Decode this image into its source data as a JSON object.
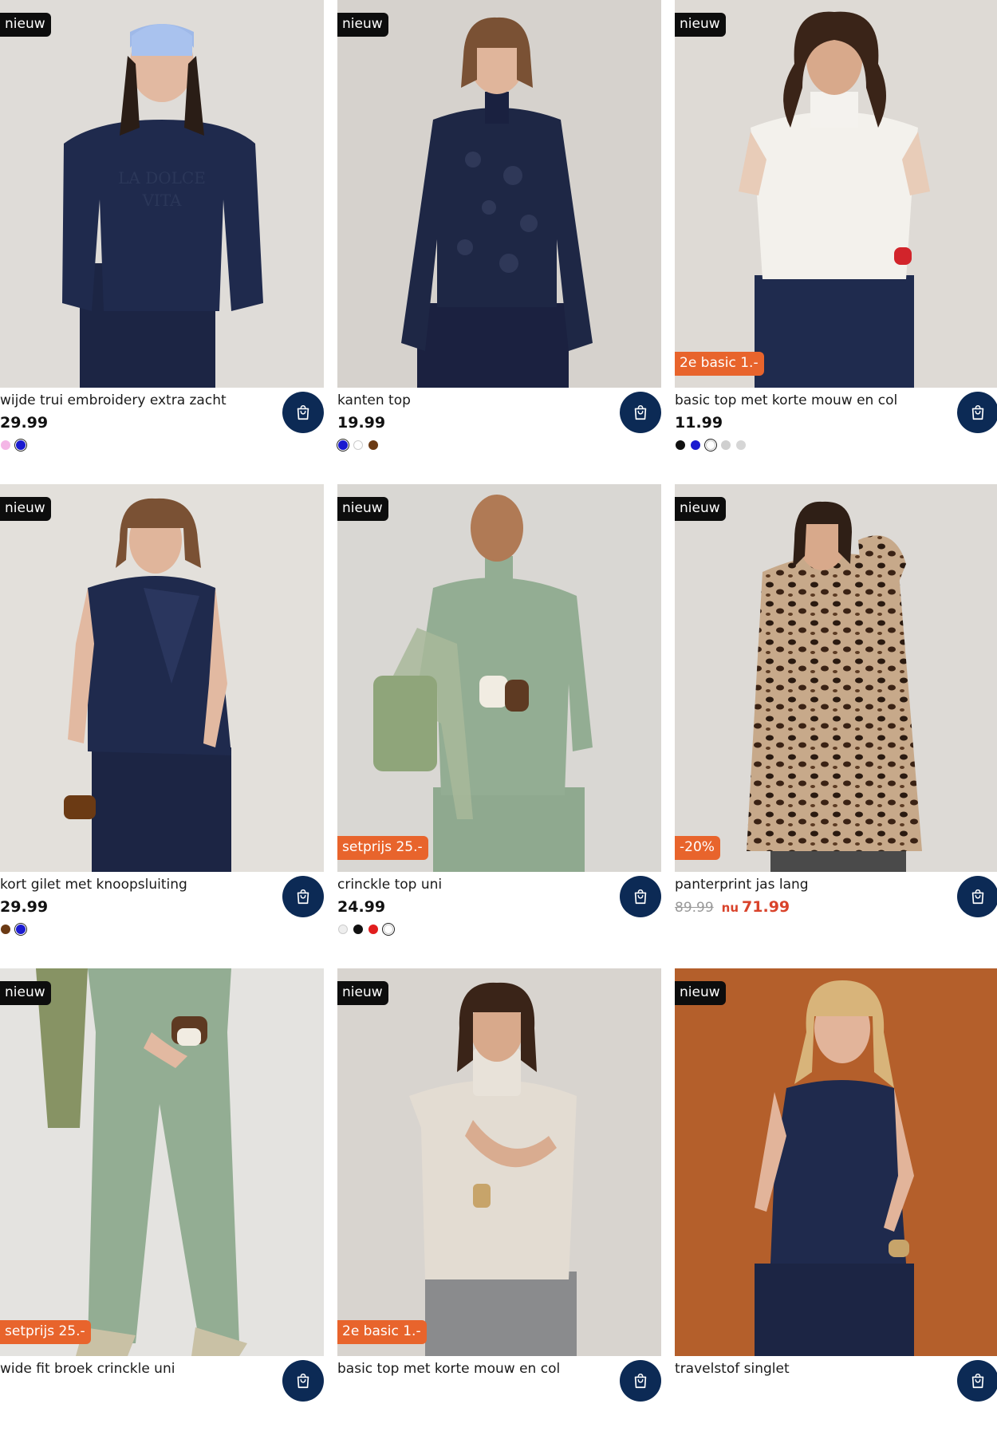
{
  "products": [
    {
      "title": "wijde trui embroidery extra zacht",
      "price": "29.99",
      "badge": "nieuw",
      "promo": "",
      "image": "woman in navy embroidered sweatshirt and blue beanie",
      "swatches": [
        "#f4b6e6",
        "#1a1ad0"
      ]
    },
    {
      "title": "kanten top",
      "price": "19.99",
      "badge": "nieuw",
      "promo": "",
      "image": "woman in navy lace top",
      "swatches": [
        "#1a1ad0",
        "#ffffff",
        "#6b3a14"
      ]
    },
    {
      "title": "basic top met korte mouw en col",
      "price": "11.99",
      "badge": "nieuw",
      "promo": "2e basic 1.-",
      "image": "woman in white short-sleeve turtleneck top",
      "swatches": [
        "#111111",
        "#1a1ad0",
        "#ffffff",
        "#cfcfcf",
        "#d6d6d6"
      ]
    },
    {
      "title": "kort gilet met knoopsluiting",
      "price": "29.99",
      "badge": "nieuw",
      "promo": "",
      "image": "woman in navy sleeveless gilet",
      "swatches": [
        "#6b3a14",
        "#1a1ad0"
      ]
    },
    {
      "title": "crinckle top uni",
      "price": "24.99",
      "badge": "nieuw",
      "promo": "setprijs 25.-",
      "image": "woman in sage green crinkle top with bag",
      "swatches": [
        "#eeeeee",
        "#111111",
        "#e11d1d",
        "#ffffff"
      ]
    },
    {
      "title": "panterprint jas lang",
      "price": "",
      "old_price": "89.99",
      "nu_label": "nu",
      "sale_price": "71.99",
      "badge": "nieuw",
      "promo": "-20%",
      "image": "woman in long leopard print coat",
      "swatches": []
    },
    {
      "title": "wide fit broek crinckle uni",
      "price": "",
      "badge": "nieuw",
      "promo": "setprijs 25.-",
      "image": "sage green crinkle wide trousers",
      "swatches": []
    },
    {
      "title": "basic top met korte mouw en col",
      "price": "",
      "badge": "nieuw",
      "promo": "2e basic 1.-",
      "image": "woman in beige short-sleeve turtleneck top",
      "swatches": []
    },
    {
      "title": "travelstof singlet",
      "price": "",
      "badge": "nieuw",
      "promo": "",
      "image": "woman in navy singlet on orange background",
      "swatches": []
    }
  ],
  "cart_button": {
    "icon": "shopping-bag-icon",
    "color": "#0c2a55"
  },
  "colors": {
    "badge_new": "#0d0d0d",
    "badge_promo": "#e8642c",
    "sale": "#d9432b"
  }
}
